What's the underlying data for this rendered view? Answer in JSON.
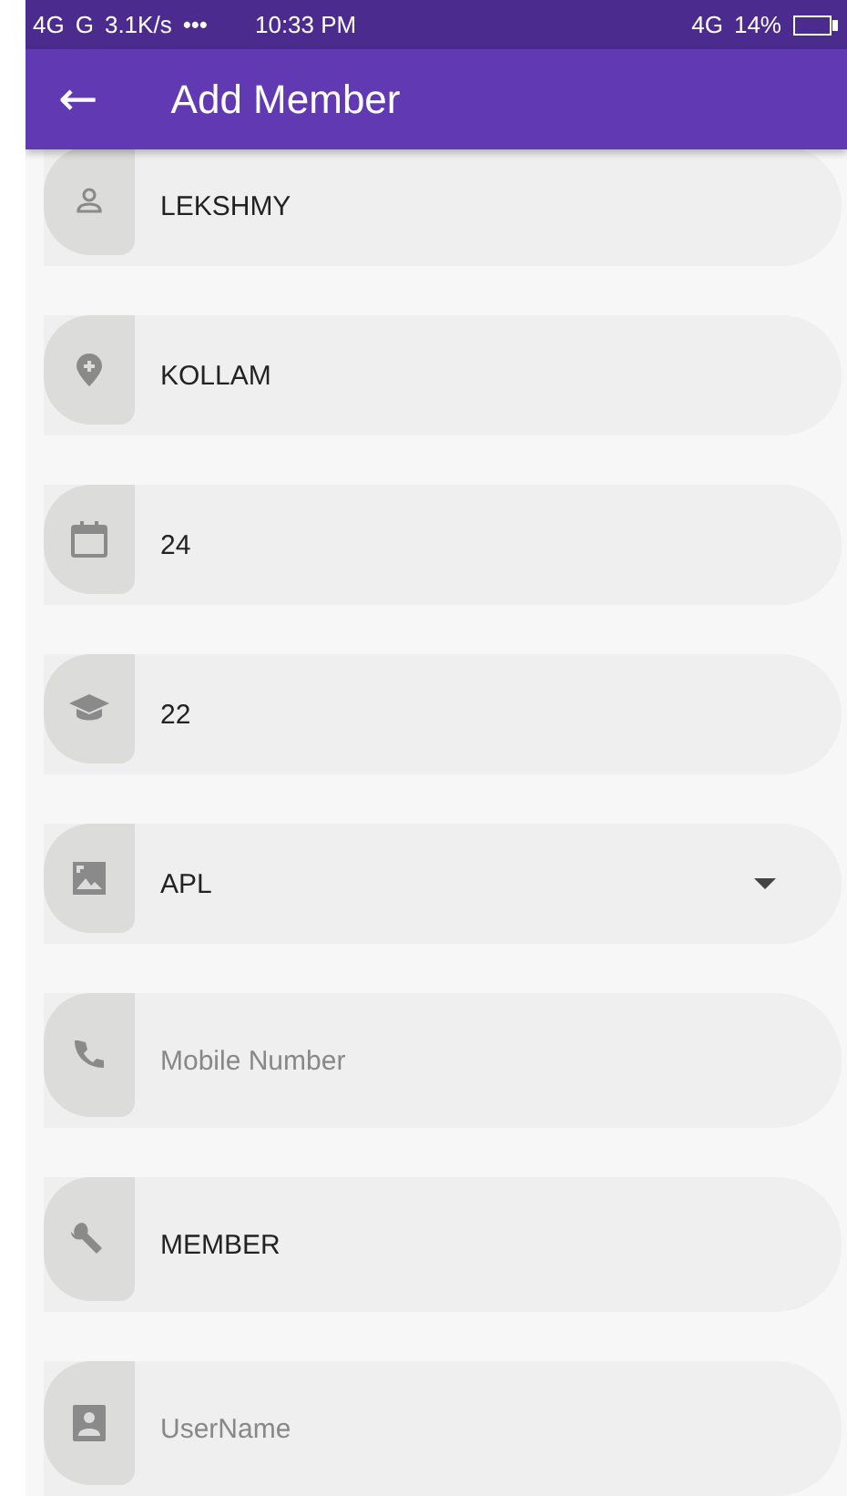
{
  "status_bar": {
    "left": "4G",
    "signal_2": "G",
    "speed": "3.1K/s",
    "more": "•••",
    "time": "10:33 PM",
    "network": "4G",
    "battery": "14%"
  },
  "app_bar": {
    "back": "←",
    "title": "Add Member"
  },
  "fields": [
    {
      "kind": "text",
      "value": "LEKSHMY"
    },
    {
      "kind": "text",
      "value": "KOLLAM"
    },
    {
      "kind": "text",
      "value": "24"
    },
    {
      "kind": "text",
      "value": "22"
    },
    {
      "kind": "dropdown",
      "value": "APL"
    },
    {
      "kind": "text",
      "placeholder": "Mobile Number"
    },
    {
      "kind": "text",
      "value": "MEMBER"
    },
    {
      "kind": "text",
      "placeholder": "UserName"
    }
  ]
}
